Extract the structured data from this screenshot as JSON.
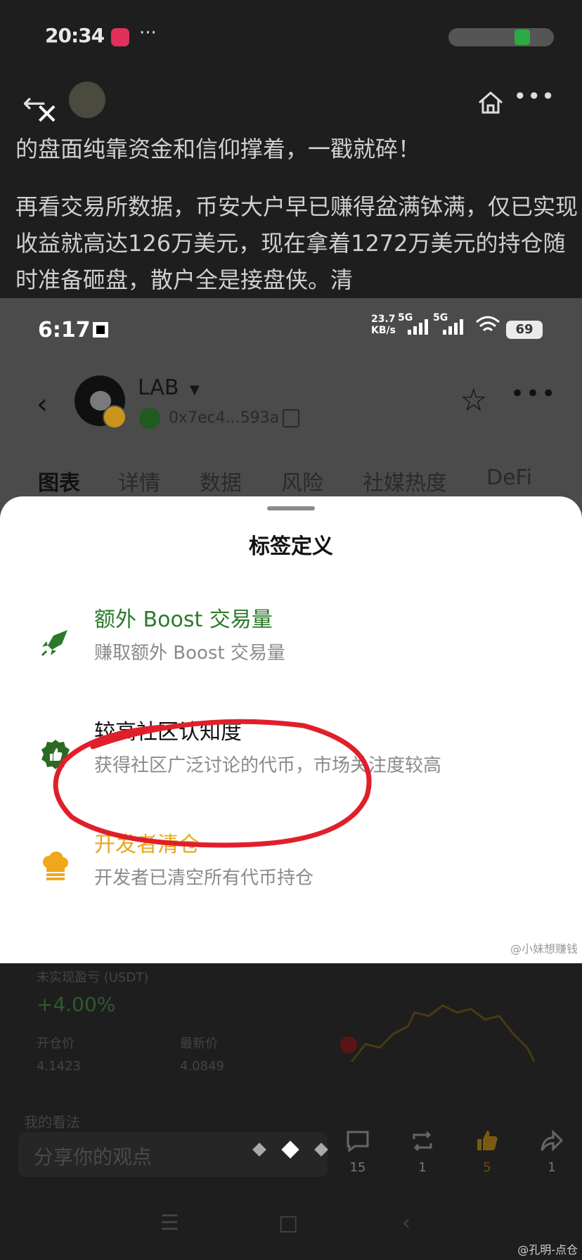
{
  "outer": {
    "time": "20:34",
    "dots": "···",
    "article": [
      "的盘面纯靠资金和信仰撑着，一戳就碎！",
      "再看交易所数据，币安大户早已赚得盆满钵满，仅已实现收益就高达126万美元，现在拿着1272万美元的持仓随时准备砸盘，散户全是接盘侠。清"
    ],
    "icons": [
      "back-arrow-icon",
      "close-icon",
      "home-icon",
      "more-icon"
    ]
  },
  "inner": {
    "status": {
      "time": "6:17",
      "net_speed": "23.7\nKB/s",
      "net_a": "5G",
      "net_b": "5G",
      "battery": "69"
    },
    "token": {
      "name": "LAB",
      "address": "0x7ec4...593a"
    },
    "tabs": [
      "图表",
      "详情",
      "数据",
      "风险",
      "社媒热度",
      "DeFi"
    ],
    "sheet": {
      "title": "标签定义",
      "items": [
        {
          "title": "额外 Boost 交易量",
          "desc": "赚取额外 Boost 交易量",
          "icon": "rocket-icon",
          "color": "#2b7a2b"
        },
        {
          "title": "较高社区认知度",
          "desc": "获得社区广泛讨论的代币，市场关注度较高",
          "icon": "thumbs-up-badge-icon",
          "color": "#111111"
        },
        {
          "title": "开发者清仓",
          "desc": "开发者已清空所有代币持仓",
          "icon": "chef-hat-icon",
          "color": "#e6a91b"
        }
      ],
      "watermark": "@小妹想赚钱"
    }
  },
  "lower": {
    "pnl_label": "未实现盈亏 (USDT)",
    "pnl_pct": "+4.00%",
    "open_label": "开仓价",
    "open_value": "4.1423",
    "last_label": "最新价",
    "last_value": "4.0849",
    "section": "我的看法",
    "input_placeholder": "分享你的观点",
    "actions": [
      {
        "icon": "comment-icon",
        "count": "15"
      },
      {
        "icon": "repost-icon",
        "count": "1"
      },
      {
        "icon": "like-icon",
        "count": "5"
      },
      {
        "icon": "share-icon",
        "count": "1"
      }
    ]
  },
  "watermark": "@孔明-点仓"
}
